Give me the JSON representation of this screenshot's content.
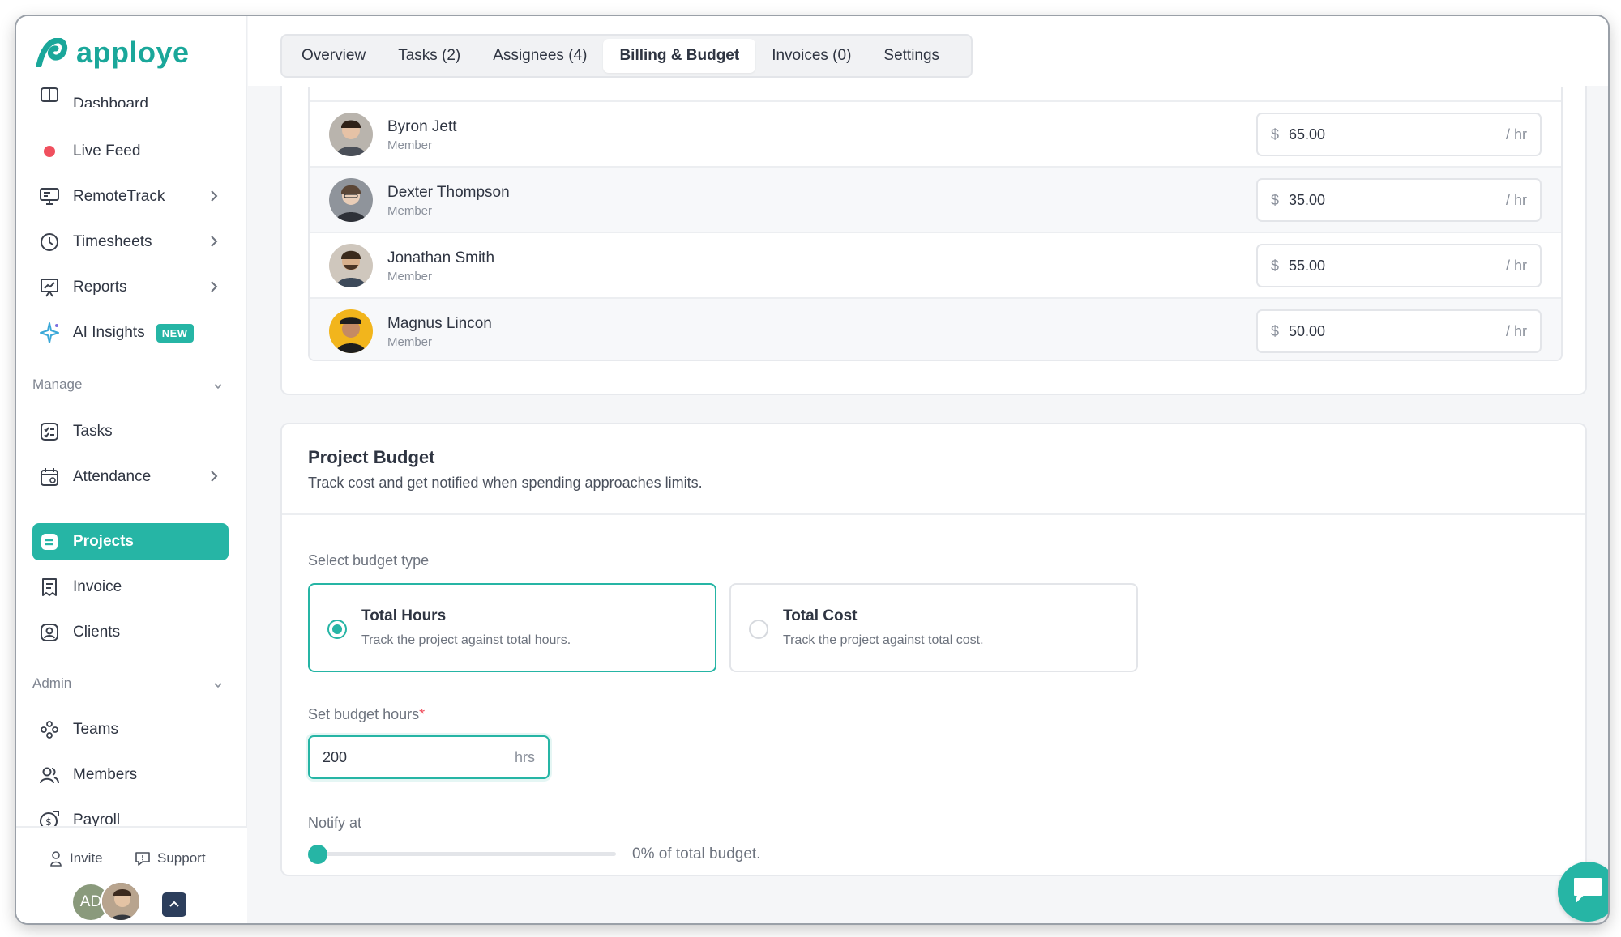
{
  "app": {
    "name": "apploye"
  },
  "sidebar": {
    "items": [
      {
        "label": "Dashboard",
        "icon": "dashboard-icon"
      },
      {
        "label": "Live Feed",
        "icon": "live-dot-icon"
      },
      {
        "label": "RemoteTrack",
        "icon": "monitor-icon"
      },
      {
        "label": "Timesheets",
        "icon": "clock-icon"
      },
      {
        "label": "Reports",
        "icon": "chart-board-icon"
      },
      {
        "label": "AI Insights",
        "icon": "sparkle-icon",
        "badge": "NEW"
      }
    ],
    "manage_label": "Manage",
    "manage_items": [
      {
        "label": "Tasks",
        "icon": "checklist-icon"
      },
      {
        "label": "Attendance",
        "icon": "calendar-icon"
      },
      {
        "label": "Projects",
        "icon": "project-icon",
        "active": true
      },
      {
        "label": "Invoice",
        "icon": "invoice-icon"
      },
      {
        "label": "Clients",
        "icon": "client-icon"
      }
    ],
    "admin_label": "Admin",
    "admin_items": [
      {
        "label": "Teams",
        "icon": "teams-icon"
      },
      {
        "label": "Members",
        "icon": "members-icon"
      },
      {
        "label": "Payroll",
        "icon": "payroll-icon"
      }
    ],
    "footer": {
      "invite": "Invite",
      "support": "Support",
      "avatar_initials": "AD"
    }
  },
  "tabs": [
    {
      "label": "Overview"
    },
    {
      "label": "Tasks (2)"
    },
    {
      "label": "Assignees (4)"
    },
    {
      "label": "Billing & Budget",
      "active": true
    },
    {
      "label": "Invoices (0)"
    },
    {
      "label": "Settings"
    }
  ],
  "members": [
    {
      "name": "Byron Jett",
      "role": "Member",
      "currency": "$",
      "rate": "65.00",
      "unit": "/ hr"
    },
    {
      "name": "Dexter Thompson",
      "role": "Member",
      "currency": "$",
      "rate": "35.00",
      "unit": "/ hr"
    },
    {
      "name": "Jonathan Smith",
      "role": "Member",
      "currency": "$",
      "rate": "55.00",
      "unit": "/ hr"
    },
    {
      "name": "Magnus Lincon",
      "role": "Member",
      "currency": "$",
      "rate": "50.00",
      "unit": "/ hr"
    }
  ],
  "budget": {
    "title": "Project Budget",
    "subtitle": "Track cost and get notified when spending approaches limits.",
    "type_label": "Select budget type",
    "types": [
      {
        "title": "Total Hours",
        "desc": "Track the project against total hours.",
        "selected": true
      },
      {
        "title": "Total Cost",
        "desc": "Track the project against total cost.",
        "selected": false
      }
    ],
    "hours_label": "Set budget hours",
    "hours_required": "*",
    "hours_value": "200",
    "hours_unit": "hrs",
    "notify_label": "Notify at",
    "notify_percent": 0,
    "notify_text": "0% of total budget."
  },
  "colors": {
    "accent": "#26b5a5",
    "live": "#f0505e"
  }
}
